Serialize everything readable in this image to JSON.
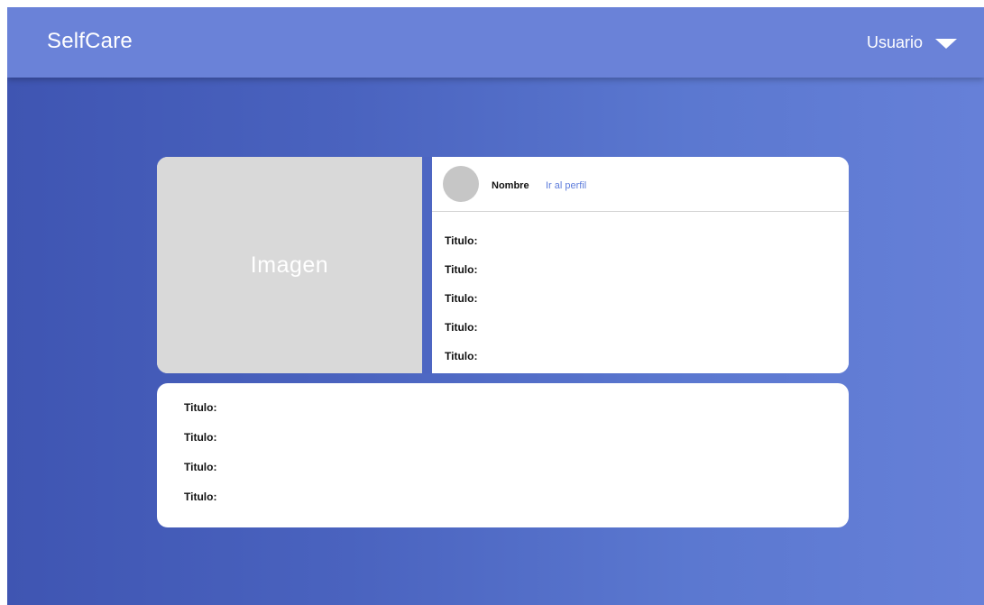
{
  "app": {
    "brand": "SelfCare"
  },
  "header": {
    "user_label": "Usuario",
    "user_dropdown_icon": "chevron-down-icon"
  },
  "post_card": {
    "image_placeholder": "Imagen",
    "profile": {
      "name": "Nombre",
      "link_label": "Ir al perfil",
      "avatar_icon": "avatar-placeholder"
    },
    "fields": [
      {
        "label": "Titulo:"
      },
      {
        "label": "Titulo:"
      },
      {
        "label": "Titulo:"
      },
      {
        "label": "Titulo:"
      },
      {
        "label": "Titulo:"
      }
    ]
  },
  "details_card": {
    "fields": [
      {
        "label": "Titulo:"
      },
      {
        "label": "Titulo:"
      },
      {
        "label": "Titulo:"
      },
      {
        "label": "Titulo:"
      }
    ]
  },
  "colors": {
    "topbar": "#6a82d8",
    "background_start": "#3f55b2",
    "background_end": "#6680d8",
    "card_background": "#ffffff",
    "image_placeholder": "#d9d9d9",
    "link": "#5d7cdb"
  }
}
